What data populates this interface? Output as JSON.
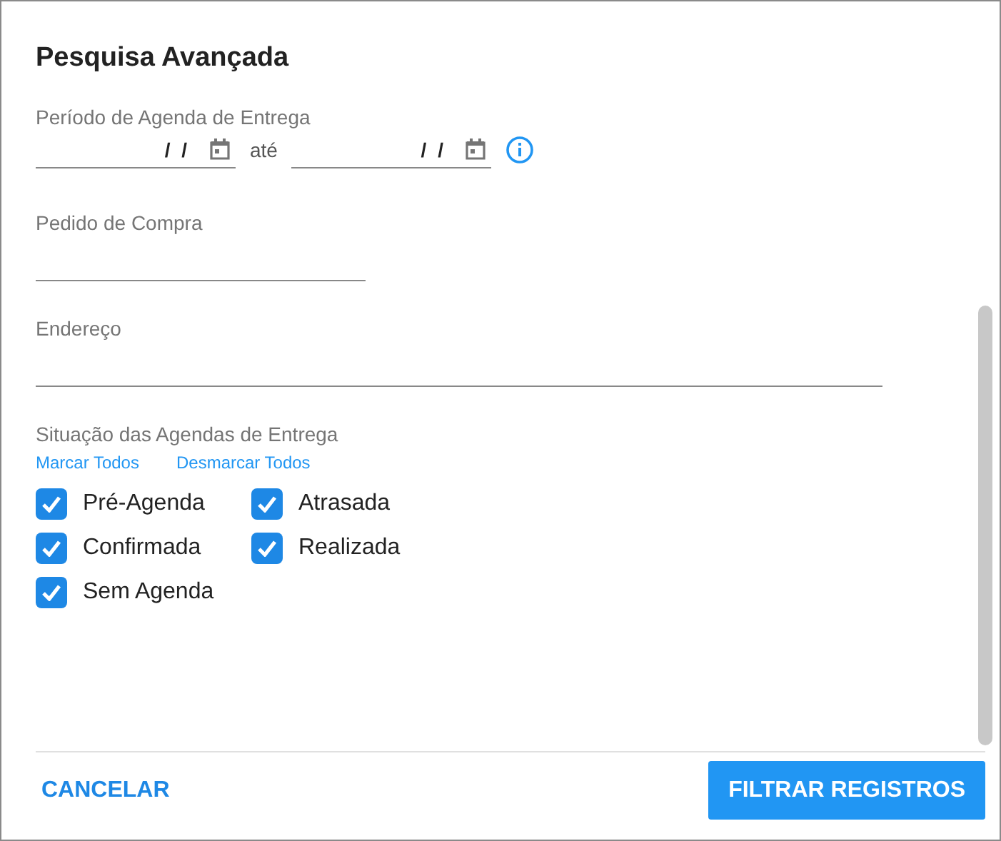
{
  "dialog": {
    "title": "Pesquisa Avançada"
  },
  "period": {
    "label": "Período de Agenda de Entrega",
    "from": {
      "value": "/ /"
    },
    "separator": "até",
    "to": {
      "value": "/ /"
    }
  },
  "order_field": {
    "label": "Pedido de Compra"
  },
  "address_field": {
    "label": "Endereço"
  },
  "status": {
    "label": "Situação das Agendas de Entrega",
    "links": [
      "Marcar Todos",
      "Desmarcar Todos"
    ],
    "options": [
      {
        "label": "Pré-Agenda",
        "checked": true
      },
      {
        "label": "Atrasada",
        "checked": true
      },
      {
        "label": "Confirmada",
        "checked": true
      },
      {
        "label": "Realizada",
        "checked": true
      },
      {
        "label": "Sem Agenda",
        "checked": true
      }
    ]
  },
  "buttons": {
    "cancel": "CANCELAR",
    "submit": "FILTRAR REGISTROS"
  }
}
